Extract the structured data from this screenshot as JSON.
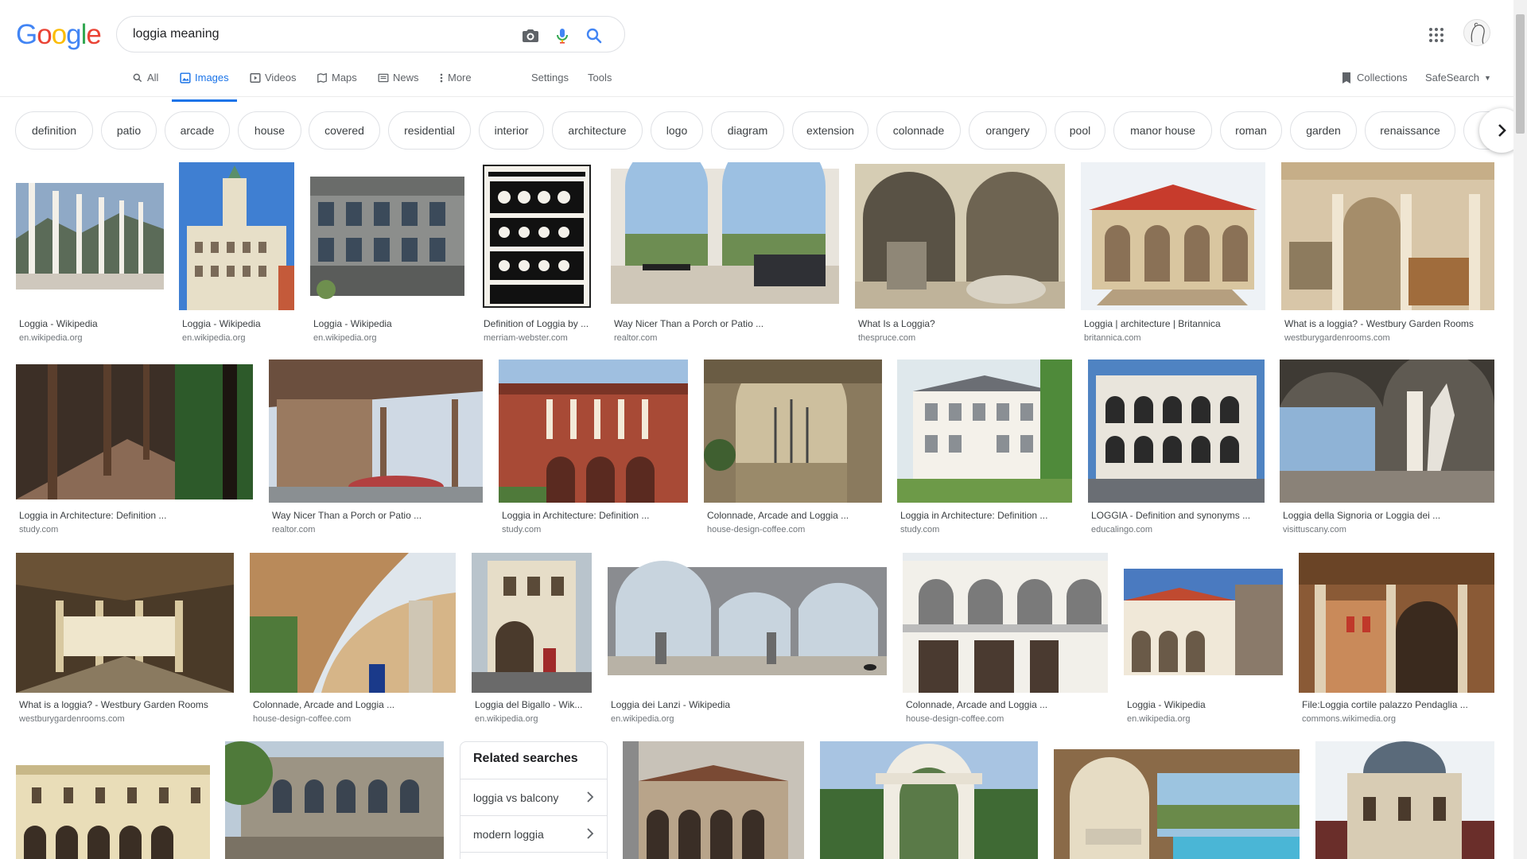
{
  "search": {
    "query": "loggia meaning"
  },
  "tabs": [
    {
      "label": "All",
      "icon": "search-icon"
    },
    {
      "label": "Images",
      "icon": "image-icon"
    },
    {
      "label": "Videos",
      "icon": "video-icon"
    },
    {
      "label": "Maps",
      "icon": "map-icon"
    },
    {
      "label": "News",
      "icon": "news-icon"
    },
    {
      "label": "More",
      "icon": "more-vert-icon"
    }
  ],
  "settings_label": "Settings",
  "tools_label": "Tools",
  "collections_label": "Collections",
  "safesearch_label": "SafeSearch",
  "chips": [
    "definition",
    "patio",
    "arcade",
    "house",
    "covered",
    "residential",
    "interior",
    "architecture",
    "logo",
    "diagram",
    "extension",
    "colonnade",
    "orangery",
    "pool",
    "manor house",
    "roman",
    "garden",
    "renaissance"
  ],
  "results": [
    {
      "title": "Loggia - Wikipedia",
      "source": "en.wikipedia.org"
    },
    {
      "title": "Loggia - Wikipedia",
      "source": "en.wikipedia.org"
    },
    {
      "title": "Loggia - Wikipedia",
      "source": "en.wikipedia.org"
    },
    {
      "title": "Definition of Loggia by ...",
      "source": "merriam-webster.com"
    },
    {
      "title": "Way Nicer Than a Porch or Patio ...",
      "source": "realtor.com"
    },
    {
      "title": "What Is a Loggia?",
      "source": "thespruce.com"
    },
    {
      "title": "Loggia | architecture | Britannica",
      "source": "britannica.com"
    },
    {
      "title": "What is a loggia? - Westbury Garden Rooms",
      "source": "westburygardenrooms.com"
    },
    {
      "title": "Loggia in Architecture: Definition ...",
      "source": "study.com"
    },
    {
      "title": "Way Nicer Than a Porch or Patio ...",
      "source": "realtor.com"
    },
    {
      "title": "Loggia in Architecture: Definition ...",
      "source": "study.com"
    },
    {
      "title": "Colonnade, Arcade and Loggia ...",
      "source": "house-design-coffee.com"
    },
    {
      "title": "Loggia in Architecture: Definition ...",
      "source": "study.com"
    },
    {
      "title": "LOGGIA - Definition and synonyms ...",
      "source": "educalingo.com"
    },
    {
      "title": "Loggia della Signoria or Loggia dei ...",
      "source": "visittuscany.com"
    },
    {
      "title": "What is a loggia? - Westbury Garden Rooms",
      "source": "westburygardenrooms.com"
    },
    {
      "title": "Colonnade, Arcade and Loggia ...",
      "source": "house-design-coffee.com"
    },
    {
      "title": "Loggia del Bigallo - Wik...",
      "source": "en.wikipedia.org"
    },
    {
      "title": "Loggia dei Lanzi - Wikipedia",
      "source": "en.wikipedia.org"
    },
    {
      "title": "Colonnade, Arcade and Loggia ...",
      "source": "house-design-coffee.com"
    },
    {
      "title": "Loggia - Wikipedia",
      "source": "en.wikipedia.org"
    },
    {
      "title": "File:Loggia cortile palazzo Pendaglia ...",
      "source": "commons.wikimedia.org"
    }
  ],
  "related": {
    "title": "Related searches",
    "items": [
      "loggia vs balcony",
      "modern loggia"
    ]
  },
  "colors": {
    "accent": "#1a73e8",
    "text": "#202124",
    "muted": "#70757a"
  }
}
